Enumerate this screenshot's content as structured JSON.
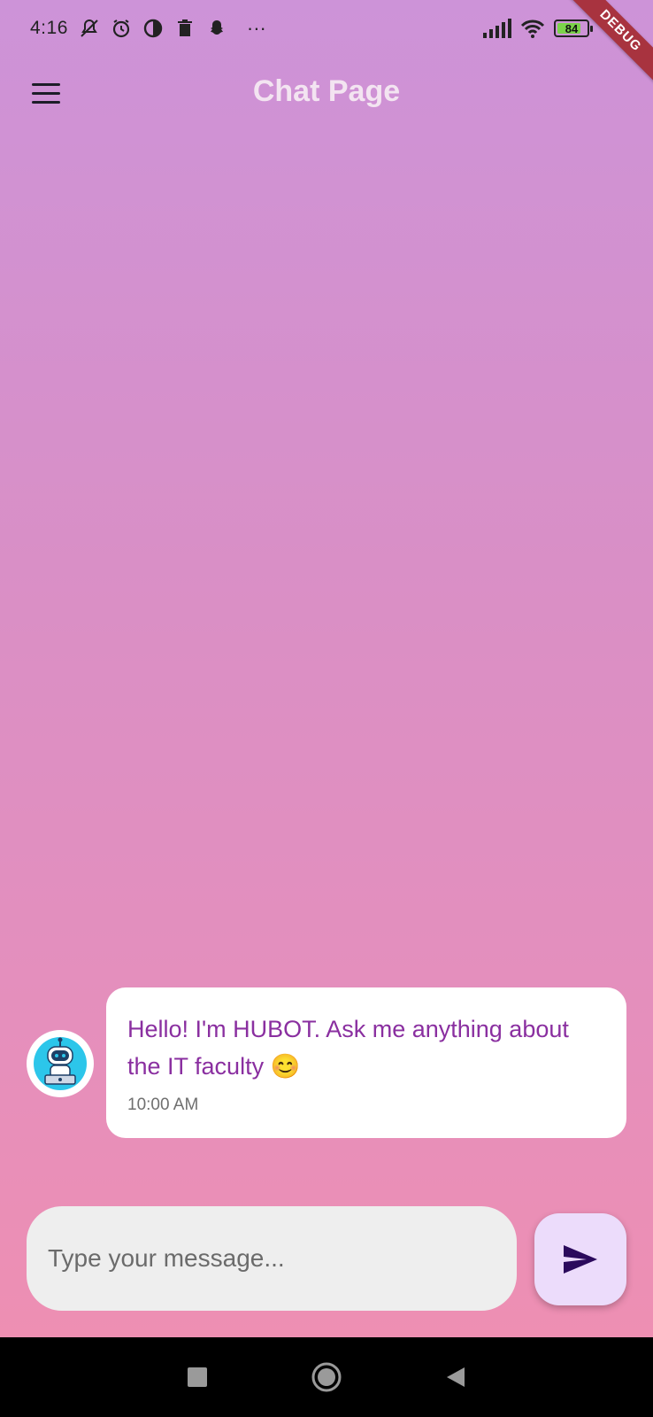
{
  "status_bar": {
    "time": "4:16",
    "more_indicator": "···",
    "battery_level": "84",
    "battery_fraction": 0.84,
    "icons": [
      "mute-icon",
      "alarm-icon",
      "data-saver-icon",
      "trash-icon",
      "snapchat-icon",
      "signal-icon",
      "wifi-icon",
      "battery-icon"
    ]
  },
  "debug_banner": {
    "label": "DEBUG"
  },
  "app_bar": {
    "title": "Chat Page",
    "menu_icon": "hamburger-menu-icon"
  },
  "messages": [
    {
      "sender": "bot",
      "avatar_icon": "robot-avatar-icon",
      "text": "Hello! I'm HUBOT. Ask me anything about the IT faculty 😊",
      "time": "10:00 AM"
    }
  ],
  "composer": {
    "placeholder": "Type your message...",
    "value": "",
    "send_icon": "send-icon"
  },
  "nav_bar": {
    "buttons": [
      "recents-square-icon",
      "home-circle-icon",
      "back-triangle-icon"
    ]
  },
  "colors": {
    "background_top": "#cd93d8",
    "background_bottom": "#f08fb0",
    "message_text": "#8a2fa0",
    "send_button_bg": "#ecdcfb",
    "send_icon": "#2b0a5c",
    "debug_ribbon": "#a8333f"
  }
}
